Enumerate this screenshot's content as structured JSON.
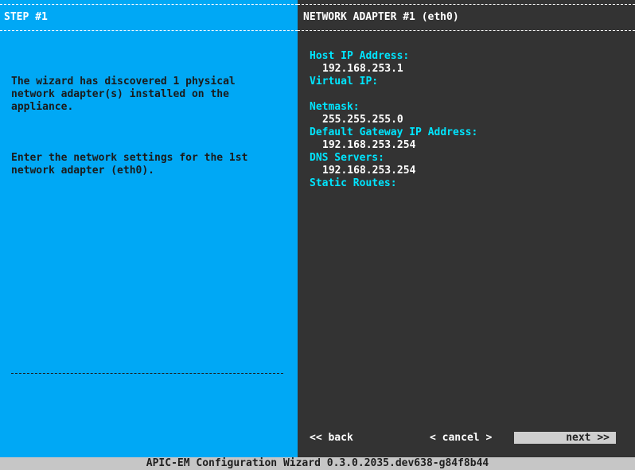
{
  "left_panel": {
    "title": "STEP #1",
    "paragraphs": [
      "The wizard has discovered 1 physical\nnetwork adapter(s) installed on the\nappliance.",
      "Enter the network settings for the 1st\nnetwork adapter (eth0)."
    ],
    "colors": {
      "background": "#00a8f5",
      "text": "#1b1b1b"
    }
  },
  "right_panel": {
    "title": "NETWORK ADAPTER #1 (eth0)",
    "fields": {
      "host_ip": {
        "label": "Host IP Address:",
        "value": "192.168.253.1"
      },
      "virtual_ip": {
        "label": "Virtual IP:",
        "value": ""
      },
      "netmask": {
        "label": "Netmask:",
        "value": "255.255.255.0"
      },
      "gateway": {
        "label": "Default Gateway IP Address:",
        "value": "192.168.253.254"
      },
      "dns": {
        "label": "DNS Servers:",
        "value": "192.168.253.254"
      },
      "static_routes": {
        "label": "Static Routes:",
        "value": ""
      }
    },
    "colors": {
      "background": "#333333",
      "label": "#00e5ff",
      "value": "#ffffff"
    }
  },
  "navigation": {
    "back_label": "<< back",
    "cancel_label": "< cancel >",
    "next_label": "next >>"
  },
  "status_bar": {
    "text": "APIC-EM Configuration Wizard 0.3.0.2035.dev638-g84f8b44"
  }
}
